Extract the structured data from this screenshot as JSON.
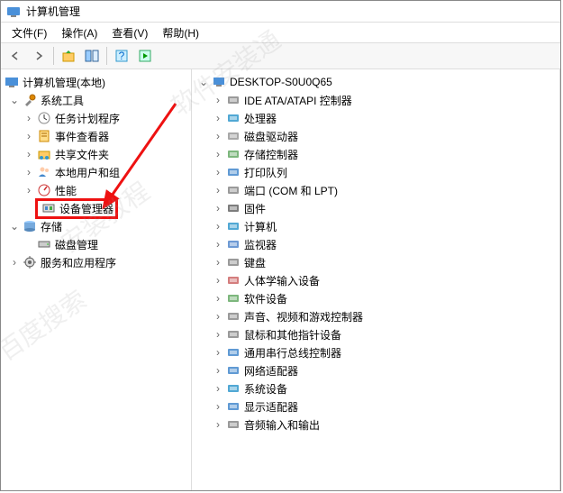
{
  "window": {
    "title": "计算机管理"
  },
  "menu": {
    "file": "文件(F)",
    "action": "操作(A)",
    "view": "查看(V)",
    "help": "帮助(H)"
  },
  "left_tree": {
    "root": "计算机管理(本地)",
    "system_tools": "系统工具",
    "task_scheduler": "任务计划程序",
    "event_viewer": "事件查看器",
    "shared_folders": "共享文件夹",
    "local_users": "本地用户和组",
    "performance": "性能",
    "device_manager": "设备管理器",
    "storage": "存储",
    "disk_management": "磁盘管理",
    "services_apps": "服务和应用程序"
  },
  "right_tree": {
    "computer": "DESKTOP-S0U0Q65",
    "items": [
      "IDE ATA/ATAPI 控制器",
      "处理器",
      "磁盘驱动器",
      "存储控制器",
      "打印队列",
      "端口 (COM 和 LPT)",
      "固件",
      "计算机",
      "监视器",
      "键盘",
      "人体学输入设备",
      "软件设备",
      "声音、视频和游戏控制器",
      "鼠标和其他指针设备",
      "通用串行总线控制器",
      "网络适配器",
      "系统设备",
      "显示适配器",
      "音频输入和输出"
    ]
  },
  "watermarks": [
    "软件安装通",
    "安装教程",
    "百度搜索"
  ]
}
